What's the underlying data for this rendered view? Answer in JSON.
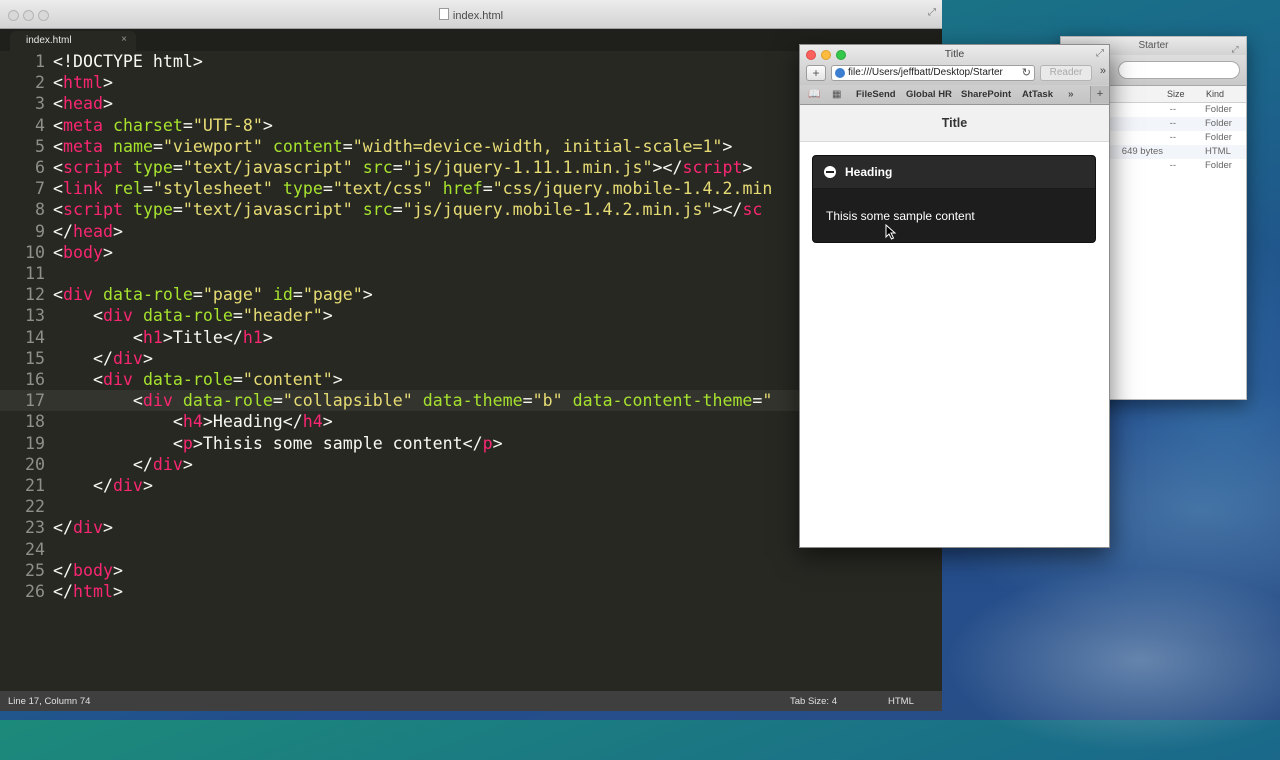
{
  "editor": {
    "title": "index.html",
    "tab_label": "index.html",
    "tab_close": "×",
    "lines": [
      [
        [
          "t",
          "wh",
          "<!DOCTYPE html>"
        ]
      ],
      [
        [
          "t",
          "wh",
          "<"
        ],
        [
          "t",
          "tg",
          "html"
        ],
        [
          "t",
          "wh",
          ">"
        ]
      ],
      [
        [
          "t",
          "wh",
          "<"
        ],
        [
          "t",
          "tg",
          "head"
        ],
        [
          "t",
          "wh",
          ">"
        ]
      ],
      [
        [
          "t",
          "wh",
          "<"
        ],
        [
          "t",
          "tg",
          "meta"
        ],
        [
          "t",
          "wh",
          " "
        ],
        [
          "t",
          "at",
          "charset"
        ],
        [
          "t",
          "wh",
          "="
        ],
        [
          "t",
          "st",
          "\"UTF-8\""
        ],
        [
          "t",
          "wh",
          ">"
        ]
      ],
      [
        [
          "t",
          "wh",
          "<"
        ],
        [
          "t",
          "tg",
          "meta"
        ],
        [
          "t",
          "wh",
          " "
        ],
        [
          "t",
          "at",
          "name"
        ],
        [
          "t",
          "wh",
          "="
        ],
        [
          "t",
          "st",
          "\"viewport\""
        ],
        [
          "t",
          "wh",
          " "
        ],
        [
          "t",
          "at",
          "content"
        ],
        [
          "t",
          "wh",
          "="
        ],
        [
          "t",
          "st",
          "\"width=device-width, initial-scale=1\""
        ],
        [
          "t",
          "wh",
          ">"
        ]
      ],
      [
        [
          "t",
          "wh",
          "<"
        ],
        [
          "t",
          "tg",
          "script"
        ],
        [
          "t",
          "wh",
          " "
        ],
        [
          "t",
          "at",
          "type"
        ],
        [
          "t",
          "wh",
          "="
        ],
        [
          "t",
          "st",
          "\"text/javascript\""
        ],
        [
          "t",
          "wh",
          " "
        ],
        [
          "t",
          "at",
          "src"
        ],
        [
          "t",
          "wh",
          "="
        ],
        [
          "t",
          "st",
          "\"js/jquery-1.11.1.min.js\""
        ],
        [
          "t",
          "wh",
          "></"
        ],
        [
          "t",
          "tg",
          "script"
        ],
        [
          "t",
          "wh",
          ">"
        ]
      ],
      [
        [
          "t",
          "wh",
          "<"
        ],
        [
          "t",
          "tg",
          "link"
        ],
        [
          "t",
          "wh",
          " "
        ],
        [
          "t",
          "at",
          "rel"
        ],
        [
          "t",
          "wh",
          "="
        ],
        [
          "t",
          "st",
          "\"stylesheet\""
        ],
        [
          "t",
          "wh",
          " "
        ],
        [
          "t",
          "at",
          "type"
        ],
        [
          "t",
          "wh",
          "="
        ],
        [
          "t",
          "st",
          "\"text/css\""
        ],
        [
          "t",
          "wh",
          " "
        ],
        [
          "t",
          "at",
          "href"
        ],
        [
          "t",
          "wh",
          "="
        ],
        [
          "t",
          "st",
          "\"css/jquery.mobile-1.4.2.min"
        ]
      ],
      [
        [
          "t",
          "wh",
          "<"
        ],
        [
          "t",
          "tg",
          "script"
        ],
        [
          "t",
          "wh",
          " "
        ],
        [
          "t",
          "at",
          "type"
        ],
        [
          "t",
          "wh",
          "="
        ],
        [
          "t",
          "st",
          "\"text/javascript\""
        ],
        [
          "t",
          "wh",
          " "
        ],
        [
          "t",
          "at",
          "src"
        ],
        [
          "t",
          "wh",
          "="
        ],
        [
          "t",
          "st",
          "\"js/jquery.mobile-1.4.2.min.js\""
        ],
        [
          "t",
          "wh",
          "></"
        ],
        [
          "t",
          "tg",
          "sc"
        ]
      ],
      [
        [
          "t",
          "wh",
          "</"
        ],
        [
          "t",
          "tg",
          "head"
        ],
        [
          "t",
          "wh",
          ">"
        ]
      ],
      [
        [
          "t",
          "wh",
          "<"
        ],
        [
          "t",
          "tg",
          "body"
        ],
        [
          "t",
          "wh",
          ">"
        ]
      ],
      [],
      [
        [
          "t",
          "wh",
          "<"
        ],
        [
          "t",
          "tg",
          "div"
        ],
        [
          "t",
          "wh",
          " "
        ],
        [
          "t",
          "at",
          "data-role"
        ],
        [
          "t",
          "wh",
          "="
        ],
        [
          "t",
          "st",
          "\"page\""
        ],
        [
          "t",
          "wh",
          " "
        ],
        [
          "t",
          "at",
          "id"
        ],
        [
          "t",
          "wh",
          "="
        ],
        [
          "t",
          "st",
          "\"page\""
        ],
        [
          "t",
          "wh",
          ">"
        ]
      ],
      [
        [
          "t",
          "wh",
          "    <"
        ],
        [
          "t",
          "tg",
          "div"
        ],
        [
          "t",
          "wh",
          " "
        ],
        [
          "t",
          "at",
          "data-role"
        ],
        [
          "t",
          "wh",
          "="
        ],
        [
          "t",
          "st",
          "\"header\""
        ],
        [
          "t",
          "wh",
          ">"
        ]
      ],
      [
        [
          "t",
          "wh",
          "        <"
        ],
        [
          "t",
          "tg",
          "h1"
        ],
        [
          "t",
          "wh",
          ">Title</"
        ],
        [
          "t",
          "tg",
          "h1"
        ],
        [
          "t",
          "wh",
          ">"
        ]
      ],
      [
        [
          "t",
          "wh",
          "    </"
        ],
        [
          "t",
          "tg",
          "div"
        ],
        [
          "t",
          "wh",
          ">"
        ]
      ],
      [
        [
          "t",
          "wh",
          "    <"
        ],
        [
          "t",
          "tg",
          "div"
        ],
        [
          "t",
          "wh",
          " "
        ],
        [
          "t",
          "at",
          "data-role"
        ],
        [
          "t",
          "wh",
          "="
        ],
        [
          "t",
          "st",
          "\"content\""
        ],
        [
          "t",
          "wh",
          ">"
        ]
      ],
      [
        [
          "t",
          "wh",
          "        <"
        ],
        [
          "t",
          "tg",
          "div"
        ],
        [
          "t",
          "wh",
          " "
        ],
        [
          "t",
          "at",
          "data-role"
        ],
        [
          "t",
          "wh",
          "="
        ],
        [
          "t",
          "st",
          "\"collapsible\""
        ],
        [
          "t",
          "wh",
          " "
        ],
        [
          "t",
          "at",
          "data-theme"
        ],
        [
          "t",
          "wh",
          "="
        ],
        [
          "t",
          "st",
          "\"b\""
        ],
        [
          "t",
          "wh",
          " "
        ],
        [
          "t",
          "at",
          "data-content-theme"
        ],
        [
          "t",
          "wh",
          "="
        ],
        [
          "t",
          "st",
          "\""
        ]
      ],
      [
        [
          "t",
          "wh",
          "            <"
        ],
        [
          "t",
          "tg",
          "h4"
        ],
        [
          "t",
          "wh",
          ">Heading</"
        ],
        [
          "t",
          "tg",
          "h4"
        ],
        [
          "t",
          "wh",
          ">"
        ]
      ],
      [
        [
          "t",
          "wh",
          "            <"
        ],
        [
          "t",
          "tg",
          "p"
        ],
        [
          "t",
          "wh",
          ">Thisis some sample content</"
        ],
        [
          "t",
          "tg",
          "p"
        ],
        [
          "t",
          "wh",
          ">"
        ]
      ],
      [
        [
          "t",
          "wh",
          "        </"
        ],
        [
          "t",
          "tg",
          "div"
        ],
        [
          "t",
          "wh",
          ">"
        ]
      ],
      [
        [
          "t",
          "wh",
          "    </"
        ],
        [
          "t",
          "tg",
          "div"
        ],
        [
          "t",
          "wh",
          ">"
        ]
      ],
      [],
      [
        [
          "t",
          "wh",
          "</"
        ],
        [
          "t",
          "tg",
          "div"
        ],
        [
          "t",
          "wh",
          ">"
        ]
      ],
      [],
      [
        [
          "t",
          "wh",
          "</"
        ],
        [
          "t",
          "tg",
          "body"
        ],
        [
          "t",
          "wh",
          ">"
        ]
      ],
      [
        [
          "t",
          "wh",
          "</"
        ],
        [
          "t",
          "tg",
          "html"
        ],
        [
          "t",
          "wh",
          ">"
        ]
      ]
    ],
    "current_line": 17,
    "status": {
      "position": "Line 17, Column 74",
      "tab_size": "Tab Size: 4",
      "syntax": "HTML"
    }
  },
  "browser": {
    "title": "Title",
    "url": "file:///Users/jeffbatt/Desktop/Starter",
    "reader": "Reader",
    "bookmarks": [
      "FileSend",
      "Global HR",
      "SharePoint",
      "AtTask"
    ],
    "page": {
      "header_title": "Title",
      "collapsible_heading": "Heading",
      "collapsible_content": "Thisis some sample content"
    }
  },
  "finder": {
    "title": "Starter",
    "columns": {
      "size": "Size",
      "kind": "Kind"
    },
    "rows": [
      {
        "size": "--",
        "kind": "Folder"
      },
      {
        "size": "--",
        "kind": "Folder"
      },
      {
        "size": "--",
        "kind": "Folder"
      },
      {
        "size": "649 bytes",
        "kind": "HTML"
      },
      {
        "size": "--",
        "kind": "Folder"
      }
    ]
  },
  "colors": {
    "editor_bg": "#272822",
    "tag": "#f92672",
    "attribute": "#a6e22e",
    "string": "#e6db74",
    "text": "#f8f8f2",
    "collapsible_bg": "#1d1d1d"
  }
}
